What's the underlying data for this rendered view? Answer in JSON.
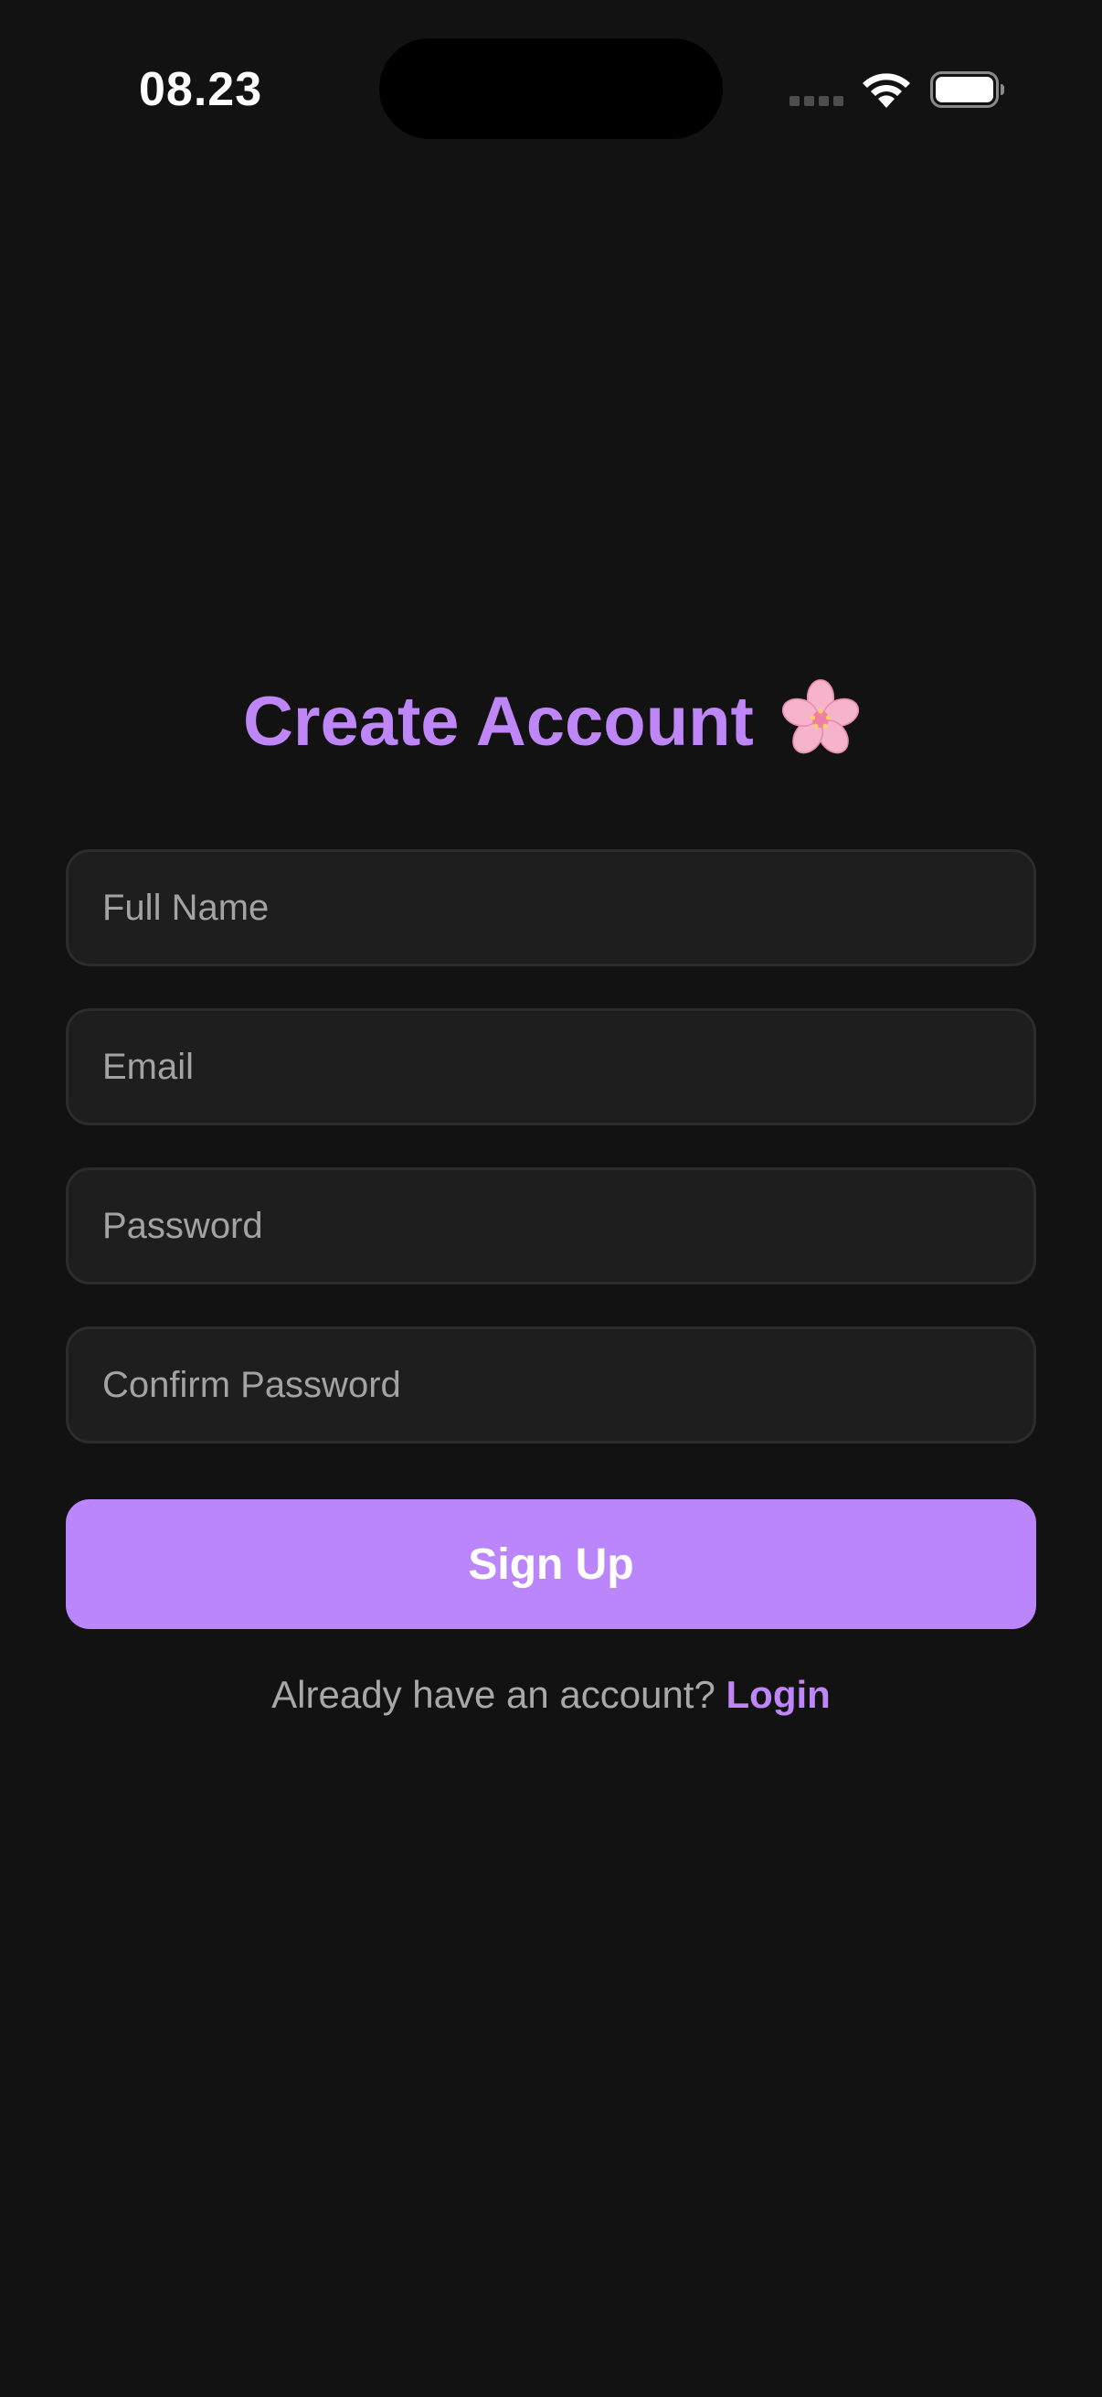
{
  "status_bar": {
    "time": "08.23"
  },
  "icons": {
    "wifi": "wifi-icon",
    "battery": "battery-icon",
    "cell_signal": "cell-signal-icon",
    "title_emoji": "cherry-blossom-icon"
  },
  "form": {
    "title": "Create Account",
    "fields": [
      {
        "placeholder": "Full Name",
        "value": ""
      },
      {
        "placeholder": "Email",
        "value": ""
      },
      {
        "placeholder": "Password",
        "value": ""
      },
      {
        "placeholder": "Confirm Password",
        "value": ""
      }
    ],
    "submit_label": "Sign Up",
    "login_prompt": "Already have an account?",
    "login_link": "Login"
  },
  "colors": {
    "background": "#121212",
    "accent": "#bb86fb",
    "field_background": "#1e1e1e",
    "placeholder": "#a3a3a3"
  }
}
